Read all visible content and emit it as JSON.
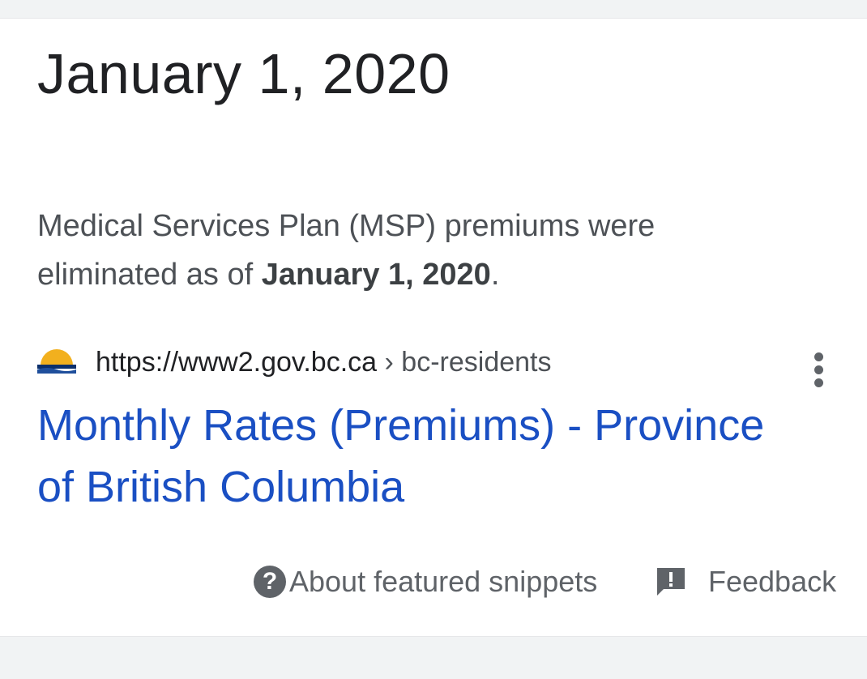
{
  "answer": {
    "title": "January 1, 2020"
  },
  "snippet": {
    "text_before": "Medical Services Plan (MSP) premiums were eliminated as of ",
    "highlight": "January 1, 2020",
    "text_after": "."
  },
  "source": {
    "favicon": "bc-gov-sunset-icon",
    "url": "https://www2.gov.bc.ca",
    "separator": " › ",
    "crumb": "bc-residents",
    "more_icon": "more-vert-icon"
  },
  "result": {
    "title": "Monthly Rates (Premiums) - Province of British Columbia"
  },
  "footer": {
    "about_icon": "help-icon",
    "about_label": "About featured snippets",
    "feedback_icon": "feedback-icon",
    "feedback_label": "Feedback"
  },
  "colors": {
    "link": "#1a4fc3",
    "text_primary": "#202124",
    "text_secondary": "#4d5156",
    "icon_gray": "#5f6368",
    "page_background": "#f1f3f4"
  }
}
